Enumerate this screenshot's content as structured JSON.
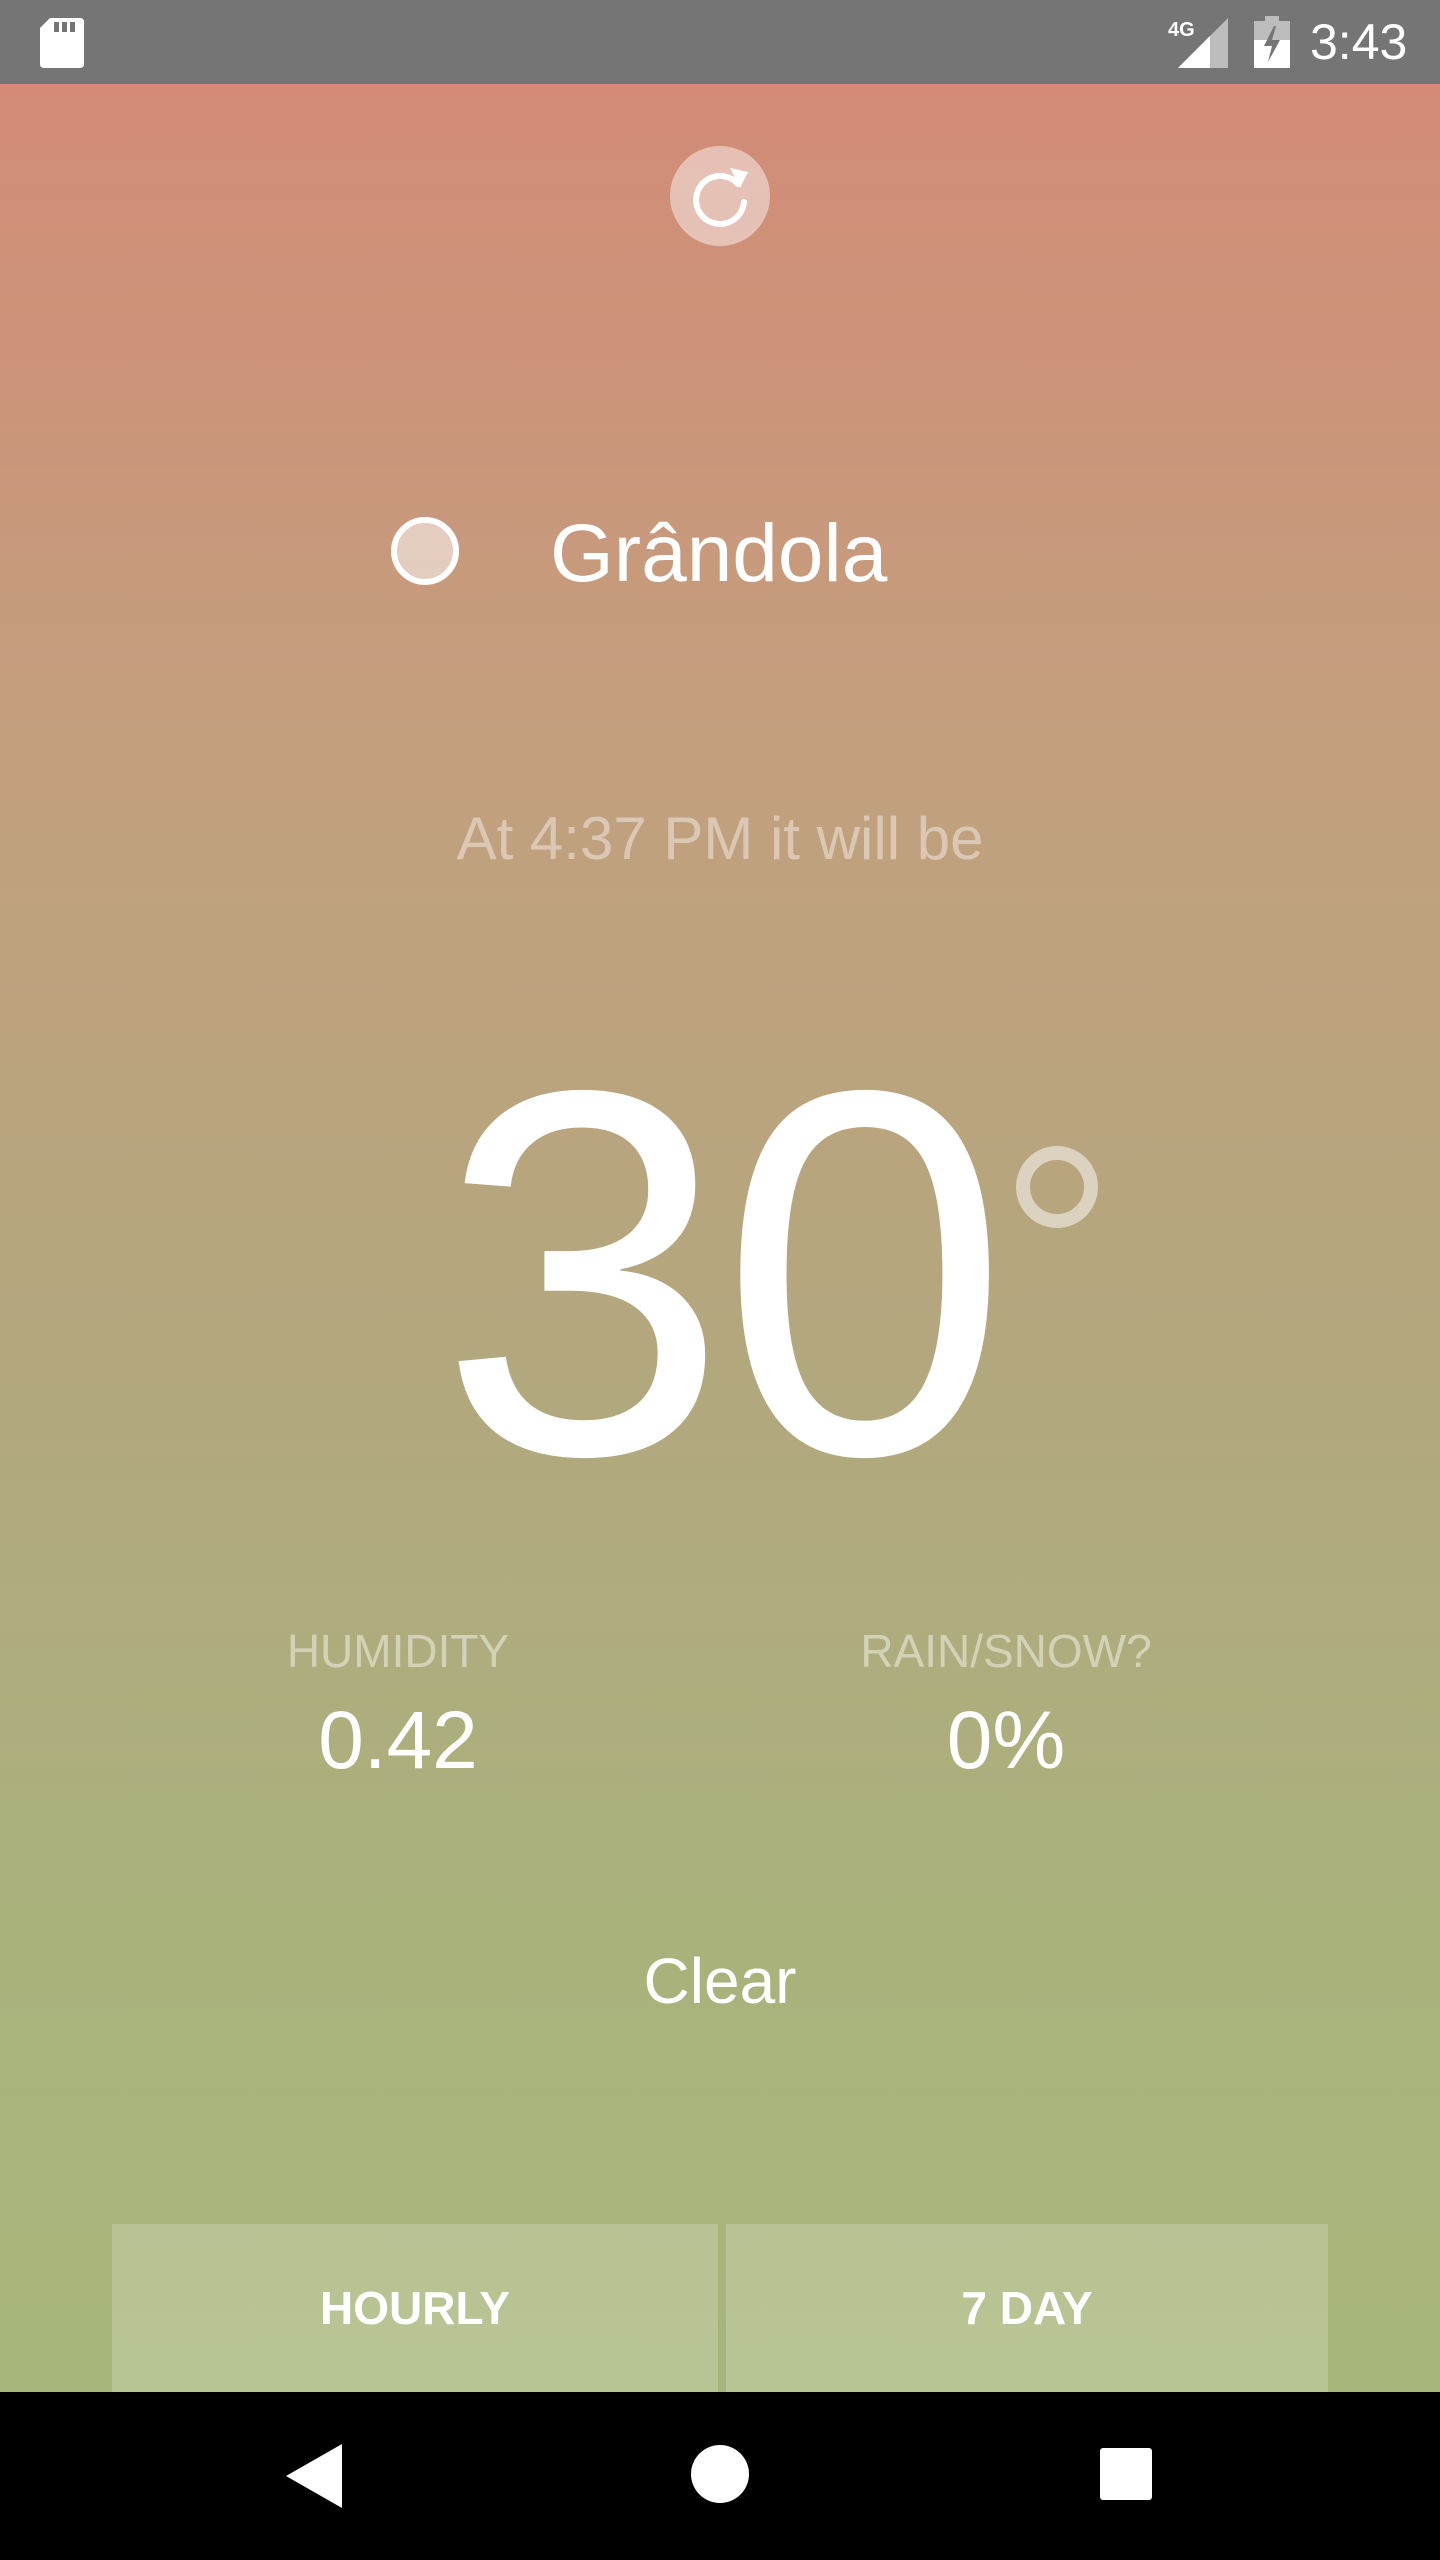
{
  "status_bar": {
    "time": "3:43",
    "network": "4G",
    "icons": [
      "sd-card-icon",
      "signal-4g-icon",
      "battery-charging-icon"
    ]
  },
  "main": {
    "refresh_icon": "refresh-icon",
    "location": {
      "icon": "location-dot-icon",
      "name": "Grândola"
    },
    "forecast_time": "At 4:37 PM it will be",
    "temperature": "30",
    "degree_icon": "degree-circle-icon",
    "humidity": {
      "label": "HUMIDITY",
      "value": "0.42"
    },
    "precipitation": {
      "label": "RAIN/SNOW?",
      "value": "0%"
    },
    "summary": "Clear",
    "buttons": {
      "hourly": "HOURLY",
      "daily": "7 DAY"
    }
  },
  "nav_bar": {
    "icons": [
      "back-icon",
      "home-icon",
      "recents-icon"
    ]
  },
  "colors": {
    "gradient_top": "#d38b77",
    "gradient_bottom": "#a6b67a",
    "status_bar": "#757575",
    "nav_bar": "#000000"
  }
}
